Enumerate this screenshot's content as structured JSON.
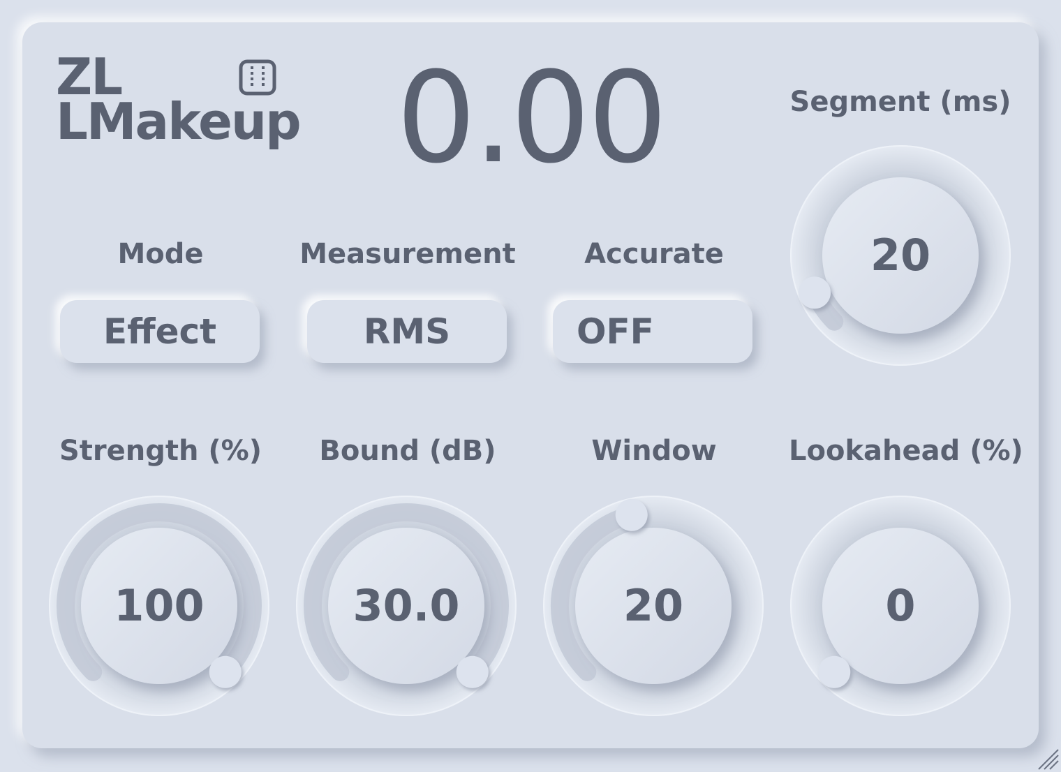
{
  "app": {
    "logo_line1": "ZL",
    "logo_line2": "LMakeup",
    "logo_icon": "meter-icon",
    "readout": "0.00"
  },
  "colors": {
    "background": "#d9dfea",
    "text": "#5a6171",
    "highlight": "#ffffff",
    "shadow": "#969eb0"
  },
  "controls": {
    "mode": {
      "label": "Mode",
      "value": "Effect"
    },
    "measurement": {
      "label": "Measurement",
      "value": "RMS"
    },
    "accurate": {
      "label": "Accurate",
      "value": "OFF"
    }
  },
  "knobs": {
    "segment": {
      "label": "Segment (ms)",
      "value": "20",
      "level": 0.08
    },
    "strength": {
      "label": "Strength (%)",
      "value": "100",
      "level": 1.0
    },
    "bound": {
      "label": "Bound (dB)",
      "value": "30.0",
      "level": 1.0
    },
    "window": {
      "label": "Window",
      "value": "20",
      "level": 0.45
    },
    "lookahead": {
      "label": "Lookahead (%)",
      "value": "0",
      "level": 0.0
    }
  },
  "icons": {
    "resize": "resize-grip-icon"
  }
}
